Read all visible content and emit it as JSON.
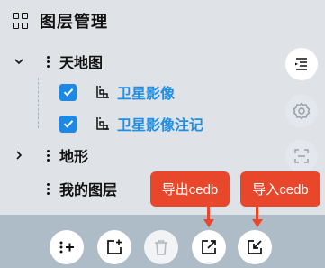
{
  "header": {
    "title": "图层管理",
    "icon": "grid-icon"
  },
  "tree": [
    {
      "label": "天地图",
      "expanded": true,
      "children": [
        {
          "label": "卫星影像",
          "checked": true
        },
        {
          "label": "卫星影像注记",
          "checked": true
        }
      ]
    },
    {
      "label": "地形",
      "expanded": false
    },
    {
      "label": "我的图层",
      "expanded": false
    }
  ],
  "side_tools": [
    "list-icon",
    "settings-icon",
    "scan-icon"
  ],
  "toolbar": [
    "add-layer-icon",
    "add-group-icon",
    "delete-icon",
    "export-icon",
    "import-icon"
  ],
  "callouts": {
    "export": "导出cedb",
    "import": "导入cedb"
  },
  "colors": {
    "accent": "#1f8fe6",
    "callout": "#e8472b",
    "toolbar_bg": "#aebcc8",
    "panel_bg": "#dfe3e8"
  }
}
